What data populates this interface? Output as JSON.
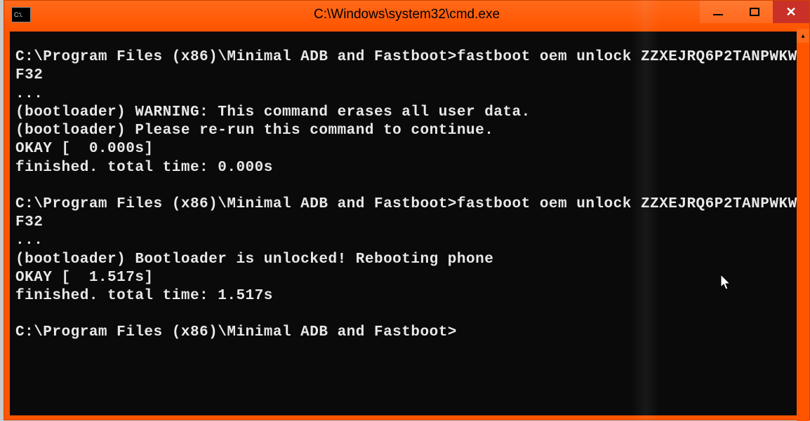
{
  "window": {
    "title": "C:\\Windows\\system32\\cmd.exe",
    "icon_text": "C:\\."
  },
  "terminal": {
    "lines": [
      "C:\\Program Files (x86)\\Minimal ADB and Fastboot>fastboot oem unlock ZZXEJRQ6P2TANPWKWF32",
      "...",
      "(bootloader) WARNING: This command erases all user data.",
      "(bootloader) Please re-run this command to continue.",
      "OKAY [  0.000s]",
      "finished. total time: 0.000s",
      "",
      "C:\\Program Files (x86)\\Minimal ADB and Fastboot>fastboot oem unlock ZZXEJRQ6P2TANPWKWF32",
      "...",
      "(bootloader) Bootloader is unlocked! Rebooting phone",
      "OKAY [  1.517s]",
      "finished. total time: 1.517s",
      "",
      "C:\\Program Files (x86)\\Minimal ADB and Fastboot>"
    ]
  }
}
